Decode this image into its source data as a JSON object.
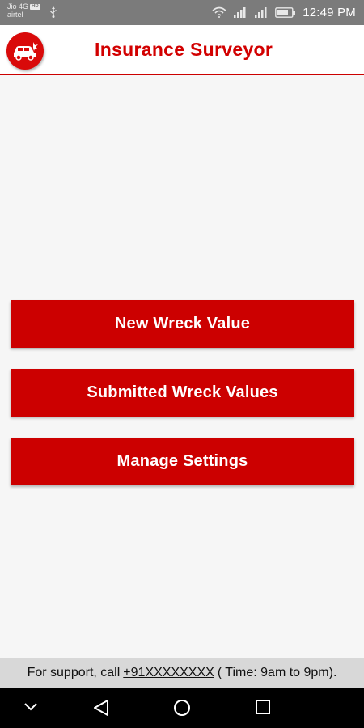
{
  "status_bar": {
    "carrier_1": "Jio 4G",
    "volte_badge": "HD",
    "carrier_2": "airtel",
    "time": "12:49 PM",
    "icons": [
      "usb-icon",
      "wifi-icon",
      "signal-icon",
      "signal-icon",
      "battery-icon"
    ]
  },
  "app_bar": {
    "title": "Insurance Surveyor",
    "logo_icon": "car-crash-icon"
  },
  "menu": {
    "new_wreck_label": "New Wreck Value",
    "submitted_label": "Submitted Wreck Values",
    "settings_label": "Manage Settings"
  },
  "support": {
    "prefix": "For support, call",
    "phone": "+91XXXXXXXX",
    "hours": "( Time: 9am to 9pm)."
  },
  "nav_bar": {
    "icons": [
      "chevron-down-icon",
      "back-icon",
      "home-icon",
      "recents-icon"
    ]
  },
  "colors": {
    "accent": "#cc0000",
    "status_bar": "#7b7b7b",
    "background": "#f6f6f6",
    "support_bar": "#d8d8d8",
    "nav_bar": "#000000"
  }
}
